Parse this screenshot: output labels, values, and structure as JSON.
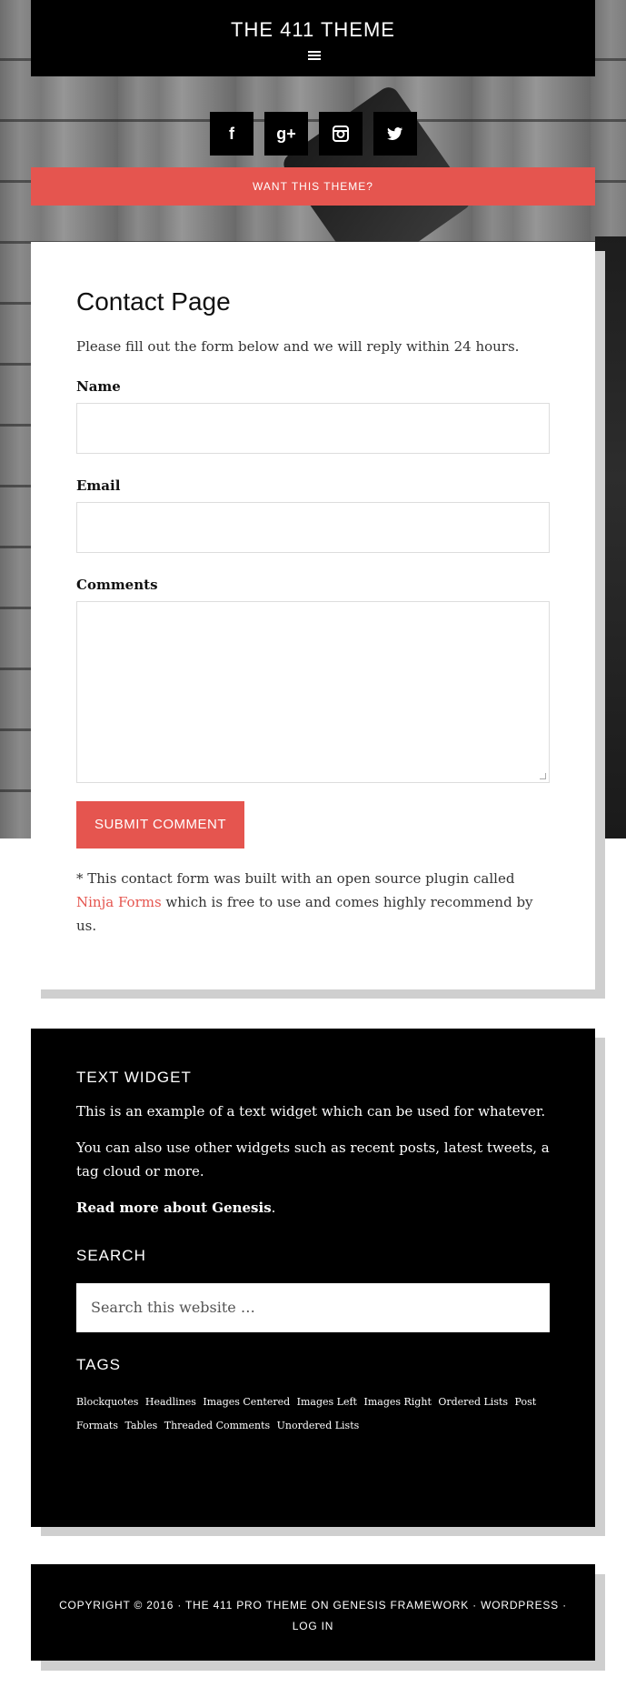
{
  "header": {
    "site_title": "THE 411 THEME"
  },
  "social": [
    {
      "icon": "facebook-icon",
      "glyph": "f"
    },
    {
      "icon": "google-plus-icon",
      "glyph": "g+"
    },
    {
      "icon": "instagram-icon",
      "glyph": "◙"
    },
    {
      "icon": "twitter-icon",
      "glyph": "🐦"
    }
  ],
  "cta": {
    "label": "WANT THIS THEME?"
  },
  "content": {
    "title": "Contact Page",
    "intro": "Please fill out the form below and we will reply within 24 hours.",
    "fields": {
      "name_label": "Name",
      "email_label": "Email",
      "comments_label": "Comments"
    },
    "submit_label": "SUBMIT COMMENT",
    "note_before": "* This contact form was built with an open source plugin called ",
    "note_link": "Ninja Forms",
    "note_after": " which is free to use and comes highly recommend by us."
  },
  "widgets": {
    "text_widget_title": "TEXT WIDGET",
    "text_widget_p1": "This is an example of a text widget which can be used for whatever.",
    "text_widget_p2": "You can also use other widgets such as recent posts, latest tweets, a tag cloud or more.",
    "text_widget_link": "Read more about Genesis",
    "search_title": "SEARCH",
    "search_placeholder": "Search this website …",
    "tags_title": "TAGS",
    "tags": [
      "Blockquotes",
      "Headlines",
      "Images Centered",
      "Images Left",
      "Images Right",
      "Ordered Lists",
      "Post Formats",
      "Tables",
      "Threaded Comments",
      "Unordered Lists"
    ]
  },
  "footer": {
    "text": "COPYRIGHT © 2016 · THE 411 PRO THEME ON GENESIS FRAMEWORK · WORDPRESS · LOG IN"
  },
  "colors": {
    "accent": "#e5554f",
    "dark": "#000000"
  }
}
